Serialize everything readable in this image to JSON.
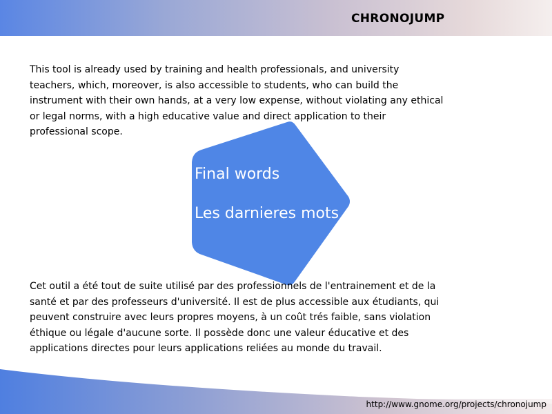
{
  "header": {
    "title": "CHRONOJUMP"
  },
  "content": {
    "paragraph_en": "This tool is already used by training and health professionals, and university teachers, which, moreover, is also accessible to students, who can build the instrument with their own hands, at a very low expense, without violating any ethical or legal norms, with a high educative value and direct application to their professional scope.",
    "pentagon_line_1": "Final words",
    "pentagon_line_2": "Les darnieres mots",
    "paragraph_fr": "Cet outil a été tout de suite utilisé par des professionnels de l'entrainement et de la santé et par des professeurs d'université. Il est de plus accessible aux étudiants, qui peuvent construire avec leurs propres moyens, à un coût trés faible, sans violation éthique ou légale d'aucune sorte. Il possède donc une valeur éducative et des applications directes pour leurs applications reliées au monde du travail."
  },
  "footer": {
    "url": "http://www.gnome.org/projects/chronojump"
  },
  "colors": {
    "accent_blue": "#4f86e6",
    "header_gradient_start": "#5a86e4",
    "header_gradient_end": "#f5efee"
  }
}
